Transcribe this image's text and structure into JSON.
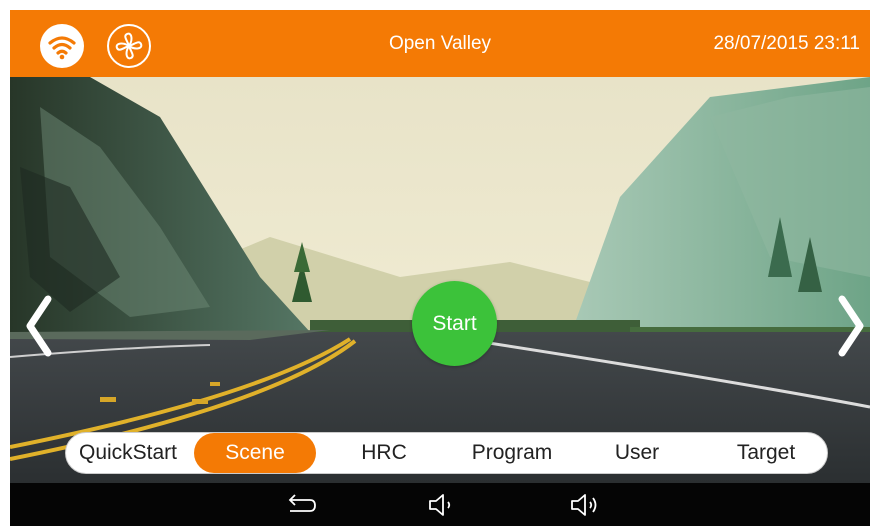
{
  "header": {
    "title": "Open Valley",
    "datetime": "28/07/2015 23:11",
    "icons": [
      "wifi-icon",
      "fan-icon"
    ]
  },
  "scene": {
    "start_label": "Start",
    "nav_icons": [
      "chevron-left-icon",
      "chevron-right-icon"
    ]
  },
  "tabs": {
    "items": [
      {
        "label": "QuickStart"
      },
      {
        "label": "Scene",
        "active": true
      },
      {
        "label": "HRC"
      },
      {
        "label": "Program"
      },
      {
        "label": "User"
      },
      {
        "label": "Target"
      }
    ]
  },
  "system_nav": {
    "icons": [
      "back-icon",
      "volume-down-icon",
      "volume-up-icon"
    ]
  },
  "colors": {
    "accent": "#f47a05",
    "start_button": "#3cc23a",
    "nav_bar": "#050505"
  }
}
